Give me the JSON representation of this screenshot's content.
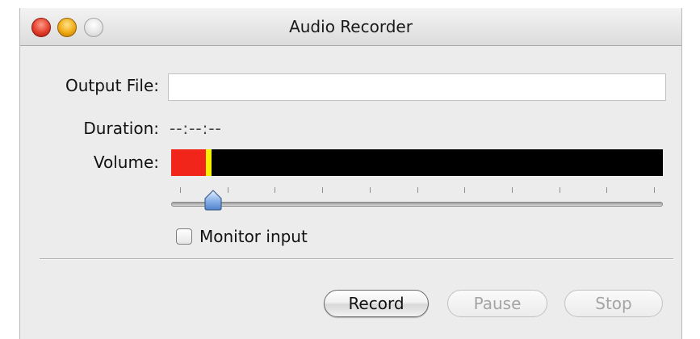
{
  "window": {
    "title": "Audio Recorder"
  },
  "form": {
    "output_file_label": "Output File:",
    "output_file_value": "",
    "duration_label": "Duration:",
    "duration_value": "--:--:--",
    "volume_label": "Volume:"
  },
  "volume_meter": {
    "level_fraction": 0.07,
    "peak_fraction": 0.078,
    "colors": {
      "background": "#000000",
      "level": "#f2251a",
      "peak": "#f7f000"
    }
  },
  "gain_slider": {
    "value_fraction": 0.07,
    "tick_count": 11
  },
  "monitor": {
    "label": "Monitor input",
    "checked": false
  },
  "buttons": {
    "record": "Record",
    "pause": "Pause",
    "stop": "Stop"
  }
}
